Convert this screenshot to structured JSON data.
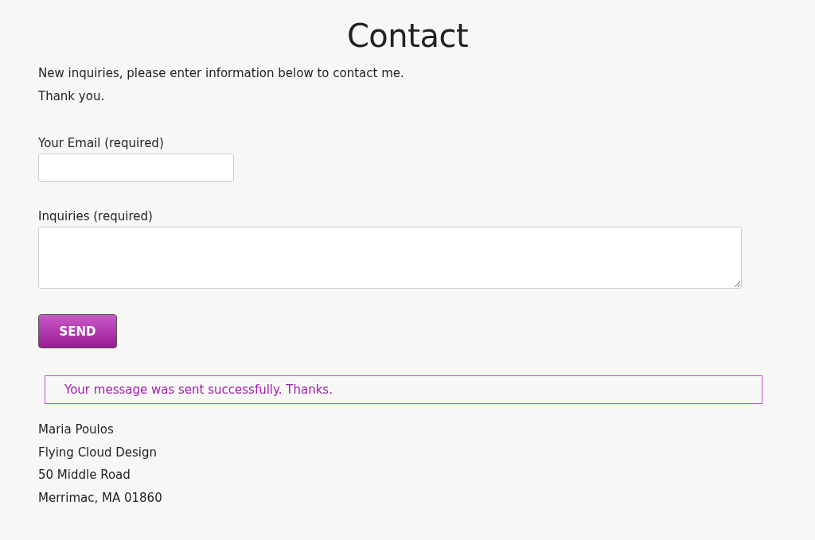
{
  "title": "Contact",
  "intro": [
    "New inquiries, please enter information below to contact me.",
    "Thank you."
  ],
  "fields": [
    {
      "label": "Your Email (required)",
      "kind": "input"
    },
    {
      "label": "Inquiries (required)",
      "kind": "textarea"
    }
  ],
  "send_button": "SEND",
  "message": "Your message was sent successfully. Thanks.",
  "address": [
    "Maria Poulos",
    "Flying Cloud Design",
    "50 Middle Road",
    "Merrimac, MA 01860"
  ]
}
